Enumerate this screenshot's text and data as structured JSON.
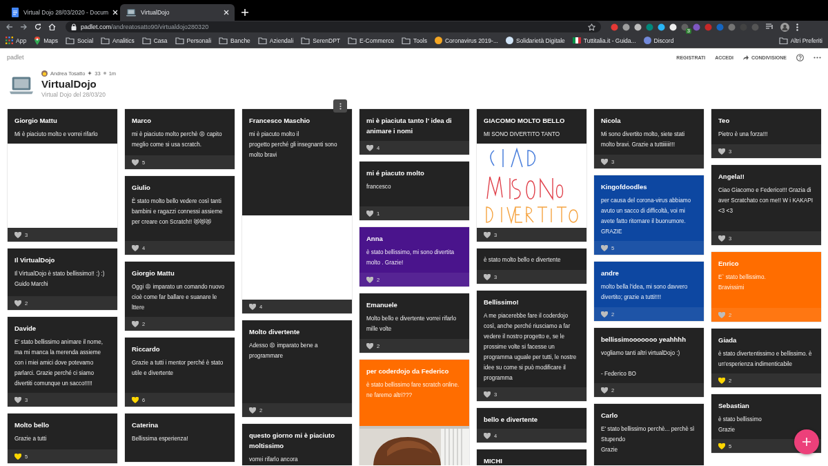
{
  "browser": {
    "tabs": [
      {
        "title": "Virtual Dojo 28/03/2020 - Docum",
        "kind": "doc",
        "selected": false
      },
      {
        "title": "VirtualDojo",
        "kind": "laptop",
        "selected": true
      }
    ],
    "url_host": "padlet.com",
    "url_path": "/andreatosatto90/virtualdojo280320",
    "extension_badge": "3",
    "bookmarks": [
      {
        "label": "App",
        "kind": "apps"
      },
      {
        "label": "Maps",
        "kind": "pin"
      },
      {
        "label": "Social",
        "kind": "folder"
      },
      {
        "label": "Analitics",
        "kind": "folder"
      },
      {
        "label": "Casa",
        "kind": "folder"
      },
      {
        "label": "Personali",
        "kind": "folder"
      },
      {
        "label": "Banche",
        "kind": "folder"
      },
      {
        "label": "Aziendali",
        "kind": "folder"
      },
      {
        "label": "SerenDPT",
        "kind": "folder"
      },
      {
        "label": "E-Commerce",
        "kind": "folder"
      },
      {
        "label": "Tools",
        "kind": "folder"
      },
      {
        "label": "Coronavirus 2019-...",
        "kind": "site",
        "color": "#f4a623"
      },
      {
        "label": "Solidarietà Digitale",
        "kind": "site",
        "color": "#d0e4f7"
      },
      {
        "label": "Tuttitalia.it - Guida...",
        "kind": "flag"
      },
      {
        "label": "Discord",
        "kind": "site",
        "color": "#7289da"
      }
    ],
    "other_bookmarks": "Altri Preferiti"
  },
  "padlet": {
    "logo": "padlet",
    "actions": [
      {
        "label": "REGISTRATI",
        "kind": "text"
      },
      {
        "label": "ACCEDI",
        "kind": "text"
      },
      {
        "label": "CONDIVISIONE",
        "kind": "share"
      }
    ],
    "author": "Andrea Tosatto",
    "karma": "33",
    "time": "1m",
    "title": "VirtualDojo",
    "subtitle": "Virtual Dojo del 28/03/20"
  },
  "columns": [
    [
      {
        "title": "Giorgio Mattu",
        "text": "Mi è piaciuto molto e vorrei rifarlo",
        "color": "#232323",
        "attachment": {
          "kind": "blank"
        },
        "likes": "3",
        "liked": false,
        "hovered": false
      },
      {
        "title": "Il VirtualDojo",
        "text": "Il VirtualDojo è stato bellissimo!! :) :) Guido Marchi",
        "color": "#232323",
        "likes": "2",
        "liked": false,
        "hovered": false
      },
      {
        "title": "Davide",
        "text": "E' stato bellissimo animare il nome, ma mi manca la merenda assieme con i miei amici dove potevamo parlarci. Grazie perché ci siamo divertiti comunque un sacco!!!!!",
        "color": "#232323",
        "likes": "3",
        "liked": false,
        "hovered": false
      },
      {
        "title": "Molto bello",
        "text": "Grazie a tutti",
        "color": "#232323",
        "likes": "5",
        "liked": true,
        "hovered": false
      }
    ],
    [
      {
        "title": "Marco",
        "text": "mi è piaciuto molto perchè 😡 capito meglio come si usa scratch.",
        "color": "#232323",
        "likes": "5",
        "liked": false,
        "hovered": false
      },
      {
        "title": "Giulio",
        "text": "È stato molto bello vedere così tanti bambini e ragazzi connessi assieme per creare con Scratch!! 😻😻😻",
        "color": "#232323",
        "likes": "4",
        "liked": false,
        "hovered": false
      },
      {
        "title": "Giorgio Mattu",
        "text": "Oggi 😡 imparato un comando nuovo cioè come far ballare e suanare le lttere",
        "color": "#232323",
        "likes": "2",
        "liked": false,
        "hovered": false
      },
      {
        "title": "Riccardo",
        "text": "Grazie a tutti i mentor perché è stato utile e divertente",
        "color": "#232323",
        "likes": "6",
        "liked": true,
        "hovered": false
      },
      {
        "title": "Caterina",
        "text": "Bellissima esperienza!",
        "color": "#232323",
        "hovered": false
      }
    ],
    [
      {
        "title": "Francesco Maschio",
        "text": "mi è piacuto molto il\nprogetto perché gli insegnanti sono molto bravi",
        "color": "#232323",
        "attachment": {
          "kind": "blank"
        },
        "likes": "4",
        "liked": false,
        "hovered": true
      },
      {
        "title": "Molto divertente",
        "text": "Adesso 😡 imparato bene a programmare",
        "color": "#232323",
        "likes": "2",
        "liked": false,
        "hovered": false
      },
      {
        "title": "questo giorno mi è  piaciuto moltissimo",
        "text": "vorrei rifarlo ancora",
        "color": "#232323",
        "hovered": false
      }
    ],
    [
      {
        "title": "mi è piaciuta tanto l' idea di animare i nomi",
        "color": "#232323",
        "likes": "4",
        "liked": false,
        "hovered": false
      },
      {
        "title": "mi é piacuto molto",
        "text": "francesco",
        "color": "#232323",
        "likes": "1",
        "liked": false,
        "hovered": false
      },
      {
        "title": "Anna",
        "text": "è stato bellissimo, mi sono divertita molto . Grazie!",
        "color": "#4a148c",
        "likes": "2",
        "liked": false,
        "hovered": false
      },
      {
        "title": "Emanuele",
        "text": "Molto bello e divertente vorrei rifarlo mille volte",
        "color": "#232323",
        "likes": "2",
        "liked": false,
        "hovered": false
      },
      {
        "title": "per coderdojo da Federico",
        "text": "è stato bellissimo fare scratch online. ne faremo altri???",
        "color": "#ff6d00",
        "hovered": false
      }
    ],
    [
      {
        "title": "GIACOMO MOLTO BELLO",
        "text": "MI SONO DIVERTITO TANTO",
        "color": "#232323",
        "attachment": {
          "kind": "drawing"
        },
        "likes": "3",
        "liked": false,
        "hovered": false
      },
      {
        "text": "è stato molto bello e divertente",
        "color": "#232323",
        "likes": "3",
        "liked": false,
        "hovered": false
      },
      {
        "title": "Bellissimo!",
        "text": "A me piacerebbe fare il coderdojo così, anche perché riusciamo a far vedere il nostro progetto e, se le prossime volte si facesse un programma uguale per tutti, le nostre idee su come si può modificare il programma",
        "color": "#232323",
        "likes": "3",
        "liked": false,
        "hovered": false
      },
      {
        "title": "bello e divertente",
        "color": "#232323",
        "likes": "4",
        "liked": false,
        "hovered": false
      },
      {
        "title": "MICHI",
        "color": "#232323",
        "hovered": false
      }
    ],
    [
      {
        "title": "Nicola",
        "text": "Mi sono divertito molto, siete stati molto bravi. Grazie a tuttiiiiii!!!",
        "color": "#232323",
        "likes": "3",
        "liked": false,
        "hovered": false
      },
      {
        "title": "Kingofdoodles",
        "text": "per causa del corona-virus abbiamo avuto un sacco di difficoltà, voi mi avete fatto ritornare il buonumore. GRAZIE",
        "color": "#0d47a1",
        "likes": "5",
        "liked": false,
        "hovered": false
      },
      {
        "title": "andre",
        "text": "molto bella l'idea, mi sono davvero divertito; grazie a tutti!!!!",
        "color": "#0d47a1",
        "likes": "2",
        "liked": false,
        "hovered": false
      },
      {
        "title": "bellissimooooooo yeahhhh",
        "text": "vogliamo tanti altri virtualDojo :)\n\n- Federico BO",
        "color": "#232323",
        "likes": "2",
        "liked": false,
        "hovered": false
      },
      {
        "title": "Carlo",
        "text": "E' stato bellissimo perchè... perchè sì\nStupendo\nGrazie",
        "color": "#232323",
        "hovered": false
      }
    ],
    [
      {
        "title": "Teo",
        "text": "Pietro è una forza!!!",
        "color": "#232323",
        "likes": "3",
        "liked": false,
        "hovered": false
      },
      {
        "title": "Angela!!",
        "text": "Ciao Giacomo e Federico!!! Grazia di aver Scratchato con me!! W i KAKAPI <3 <3",
        "color": "#232323",
        "likes": "3",
        "liked": false,
        "hovered": false
      },
      {
        "title": "Enrico",
        "text": "E` stato bellissimo.\nBravissimi",
        "color": "#ff6d00",
        "likes": "2",
        "liked": false,
        "hovered": false
      },
      {
        "title": "Giada",
        "text": "è stato divertentissimo e bellissimo. è un'esperienza indimenticabile",
        "color": "#232323",
        "likes": "2",
        "liked": true,
        "hovered": false
      },
      {
        "title": "Sebastian",
        "text": "è stato bellissimo\nGrazie",
        "color": "#232323",
        "likes": "5",
        "liked": true,
        "hovered": false
      }
    ]
  ]
}
